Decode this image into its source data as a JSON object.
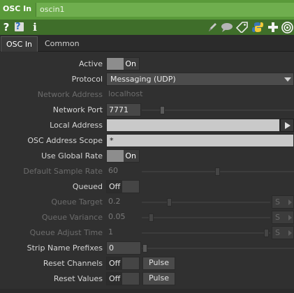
{
  "titlebar": {
    "op_type": "OSC In",
    "op_name": "oscin1"
  },
  "toolbar": {
    "help_icon": "question-mark",
    "python_help_icon": "python-help",
    "info_icon": "info",
    "right_icons": [
      "edit-pencil-icon",
      "comment-icon",
      "tag-icon",
      "python-icon",
      "plus-icon",
      "viewer-icon"
    ]
  },
  "tabs": [
    {
      "label": "OSC In",
      "active": true
    },
    {
      "label": "Common",
      "active": false
    }
  ],
  "params": {
    "active": {
      "label": "Active",
      "value": "On"
    },
    "protocol": {
      "label": "Protocol",
      "value": "Messaging (UDP)"
    },
    "network_address": {
      "label": "Network Address",
      "value": "localhost"
    },
    "network_port": {
      "label": "Network Port",
      "value": "7771"
    },
    "local_address": {
      "label": "Local Address",
      "value": ""
    },
    "osc_address_scope": {
      "label": "OSC Address Scope",
      "value": "*"
    },
    "use_global_rate": {
      "label": "Use Global Rate",
      "value": "On"
    },
    "default_sample_rate": {
      "label": "Default Sample Rate",
      "value": "60"
    },
    "queued": {
      "label": "Queued",
      "value": "Off"
    },
    "queue_target": {
      "label": "Queue Target",
      "value": "0.2",
      "units": "S"
    },
    "queue_variance": {
      "label": "Queue Variance",
      "value": "0.05",
      "units": "S"
    },
    "queue_adjust_time": {
      "label": "Queue Adjust Time",
      "value": "1",
      "units": "S"
    },
    "strip_name_prefixes": {
      "label": "Strip Name Prefixes",
      "value": "0"
    },
    "reset_channels": {
      "label": "Reset Channels",
      "value": "Off",
      "pulse": "Pulse"
    },
    "reset_values": {
      "label": "Reset Values",
      "value": "Off",
      "pulse": "Pulse"
    }
  },
  "colors": {
    "title_green": "#5a9a3a",
    "toolbar_green": "#3f6e2a",
    "panel_bg": "#303030"
  }
}
